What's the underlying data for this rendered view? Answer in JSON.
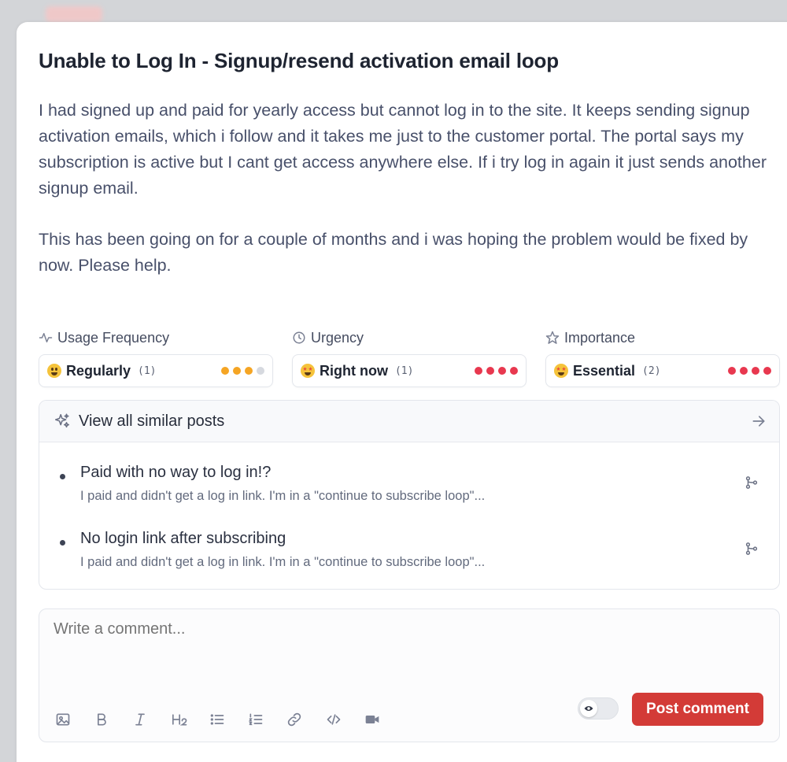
{
  "post": {
    "title": "Unable to Log In - Signup/resend activation email loop",
    "body": [
      "I had signed up and paid for yearly access but cannot log in to the site. It keeps sending signup activation emails, which i follow and it takes me just to the customer portal. The portal says my subscription is active but I cant get access anywhere else. If i try log in again it just sends another signup email.",
      "This has been going on for a couple of months and i was hoping the problem would be fixed by now. Please help."
    ]
  },
  "attributes": [
    {
      "label": "Usage Frequency",
      "icon": "activity-icon",
      "value": "Regularly",
      "count": "(1)",
      "level": 3,
      "max": 4,
      "color": "#f5a524"
    },
    {
      "label": "Urgency",
      "icon": "clock-icon",
      "value": "Right now",
      "count": "(1)",
      "level": 4,
      "max": 4,
      "color": "#e8384f"
    },
    {
      "label": "Importance",
      "icon": "star-icon",
      "value": "Essential",
      "count": "(2)",
      "level": 4,
      "max": 4,
      "color": "#e8384f"
    }
  ],
  "similar": {
    "header": "View all similar posts",
    "posts": [
      {
        "title": "Paid with no way to log in!?",
        "snippet": "I paid and didn't get a log in link. I'm in a \"continue to subscribe loop\"..."
      },
      {
        "title": "No login link after subscribing",
        "snippet": "I paid and didn't get a log in link. I'm in a \"continue to subscribe loop\"..."
      }
    ]
  },
  "comment": {
    "placeholder": "Write a comment...",
    "submit_label": "Post comment",
    "toolbar": [
      "image-icon",
      "bold-icon",
      "italic-icon",
      "heading-icon",
      "bullet-list-icon",
      "numbered-list-icon",
      "link-icon",
      "code-icon",
      "video-icon"
    ]
  },
  "colors": {
    "accent": "#d33b37",
    "dot_empty": "#d6d9df"
  }
}
